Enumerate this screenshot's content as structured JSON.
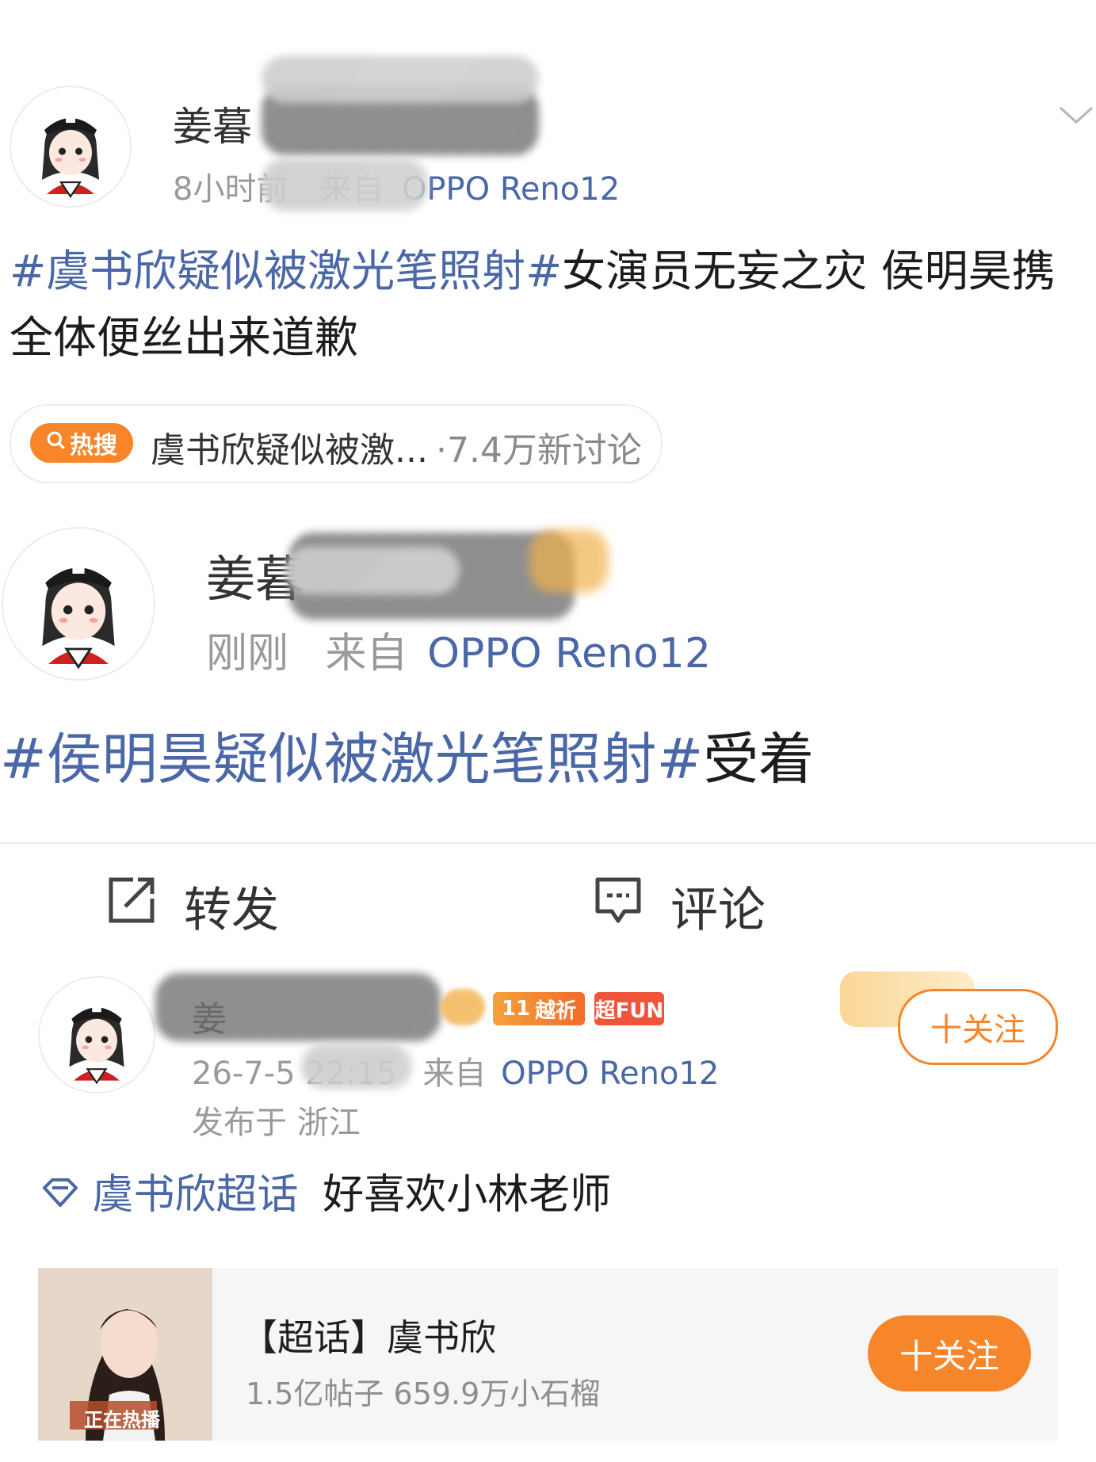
{
  "post1": {
    "username": "姜暮",
    "meta_time": "8小时前",
    "meta_from": "来自",
    "meta_device": "OPPO Reno12",
    "hashtag": "#虞书欣疑似被激光笔照射#",
    "text": "女演员无妄之灾 侯明昊携全体便丝出来道歉"
  },
  "hot_chip": {
    "badge": "热搜",
    "topic": "虞书欣疑似被激...",
    "count": "·7.4万新讨论"
  },
  "post2": {
    "username": "姜暮",
    "meta_time": "刚刚",
    "meta_from": "来自",
    "meta_device": "OPPO Reno12",
    "hashtag": "#侯明昊疑似被激光笔照射#",
    "text": "受着"
  },
  "actions": {
    "repost": "转发",
    "comment": "评论"
  },
  "comment": {
    "username": "姜",
    "level_badge": "11",
    "level_label": "越祈",
    "fun_badge": "超FUN",
    "timestamp": "26-7-5 22:15",
    "from": "来自",
    "device": "OPPO Reno12",
    "location": "发布于 浙江",
    "follow_label": "十关注",
    "topic_tag": "虞书欣超话",
    "text": "好喜欢小林老师"
  },
  "supertopic_card": {
    "title": "【超话】虞书欣",
    "stats": "1.5亿帖子 659.9万小石榴",
    "follow_label": "十关注",
    "image_caption": "正在热播"
  },
  "colors": {
    "accent": "#f7852a",
    "link": "#4a67a8",
    "meta": "#9a9a9a"
  }
}
